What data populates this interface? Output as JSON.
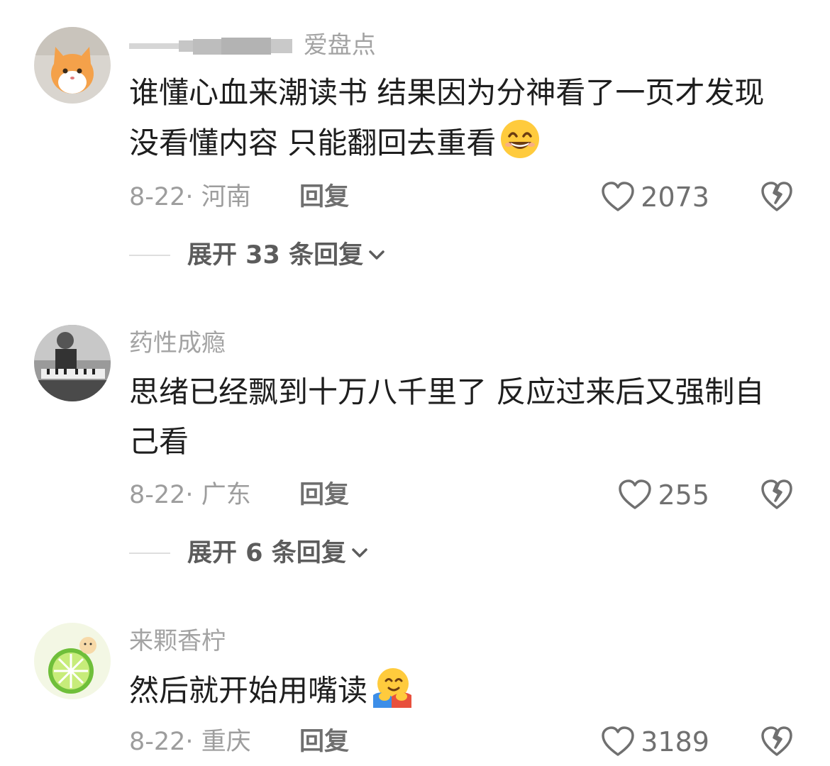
{
  "comments": [
    {
      "username_visible": "爱盘点",
      "text_line1": "谁懂心血来潮读书 结果因为分神看了一页才发现",
      "text_line2": "没看懂内容 只能翻回去重看",
      "emoji": "grinning-face-icon",
      "date": "8-22·",
      "location": "河南",
      "reply_label": "回复",
      "likes": "2073",
      "expand_label": "展开 33 条回复"
    },
    {
      "username": "药性成瘾",
      "text_line1": "思绪已经飘到十万八千里了 反应过来后又强制自",
      "text_line2": "己看",
      "date": "8-22·",
      "location": "广东",
      "reply_label": "回复",
      "likes": "255",
      "expand_label": "展开 6 条回复"
    },
    {
      "username": "来颗香柠",
      "text_line1": "然后就开始用嘴读",
      "emoji": "hugging-face-icon",
      "date": "8-22·",
      "location": "重庆",
      "reply_label": "回复",
      "likes": "3189"
    }
  ],
  "colors": {
    "text": "#1e1e1e",
    "meta": "#9d9d9d",
    "username": "#a3a3a3",
    "icon": "#707070"
  }
}
